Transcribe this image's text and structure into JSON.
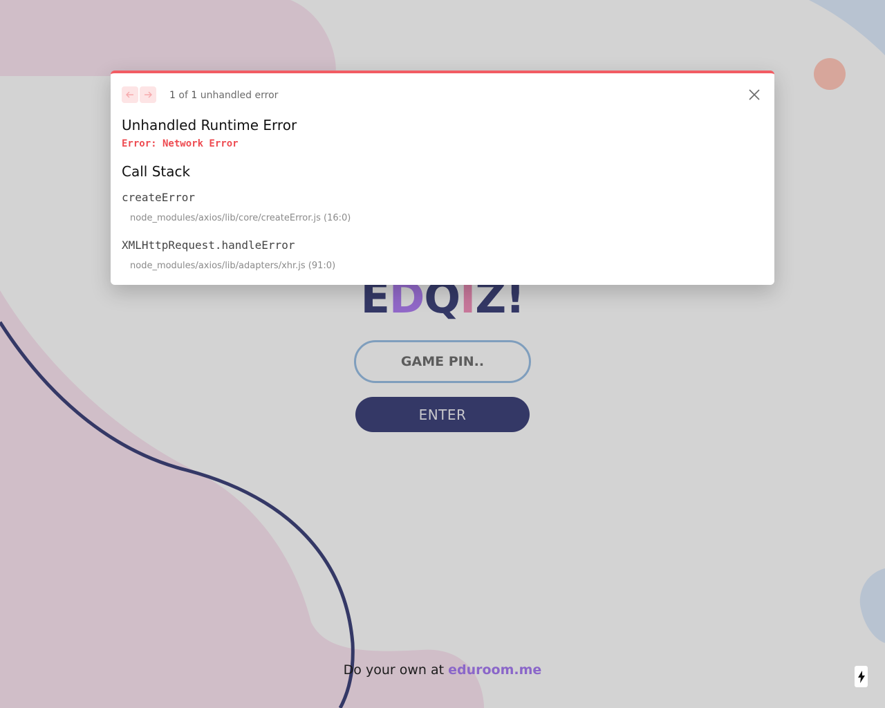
{
  "page": {
    "logo_letters": [
      "E",
      "D",
      "Q",
      "I",
      "Z",
      "!"
    ],
    "logo_colors": [
      "#343866",
      "#9168c8",
      "#343866",
      "#c7779a",
      "#343866",
      "#343866"
    ],
    "pin_placeholder": "GAME PIN..",
    "enter_label": "ENTER",
    "footer_text": "Do your own at ",
    "footer_link": "eduroom.me"
  },
  "error_overlay": {
    "count_current": "1",
    "count_total": "1",
    "count_text": "unhandled error",
    "title": "Unhandled Runtime Error",
    "message": "Error: Network Error",
    "stack_heading": "Call Stack",
    "frames": [
      {
        "fn": "createError",
        "file": "node_modules/axios/lib/core/createError.js (16:0)"
      },
      {
        "fn": "XMLHttpRequest.handleError",
        "file": "node_modules/axios/lib/adapters/xhr.js (91:0)"
      }
    ],
    "icons": {
      "prev": "arrow-left-icon",
      "next": "arrow-right-icon",
      "close": "close-icon",
      "dev": "lightning-icon"
    },
    "accent_color": "#f25c63"
  }
}
